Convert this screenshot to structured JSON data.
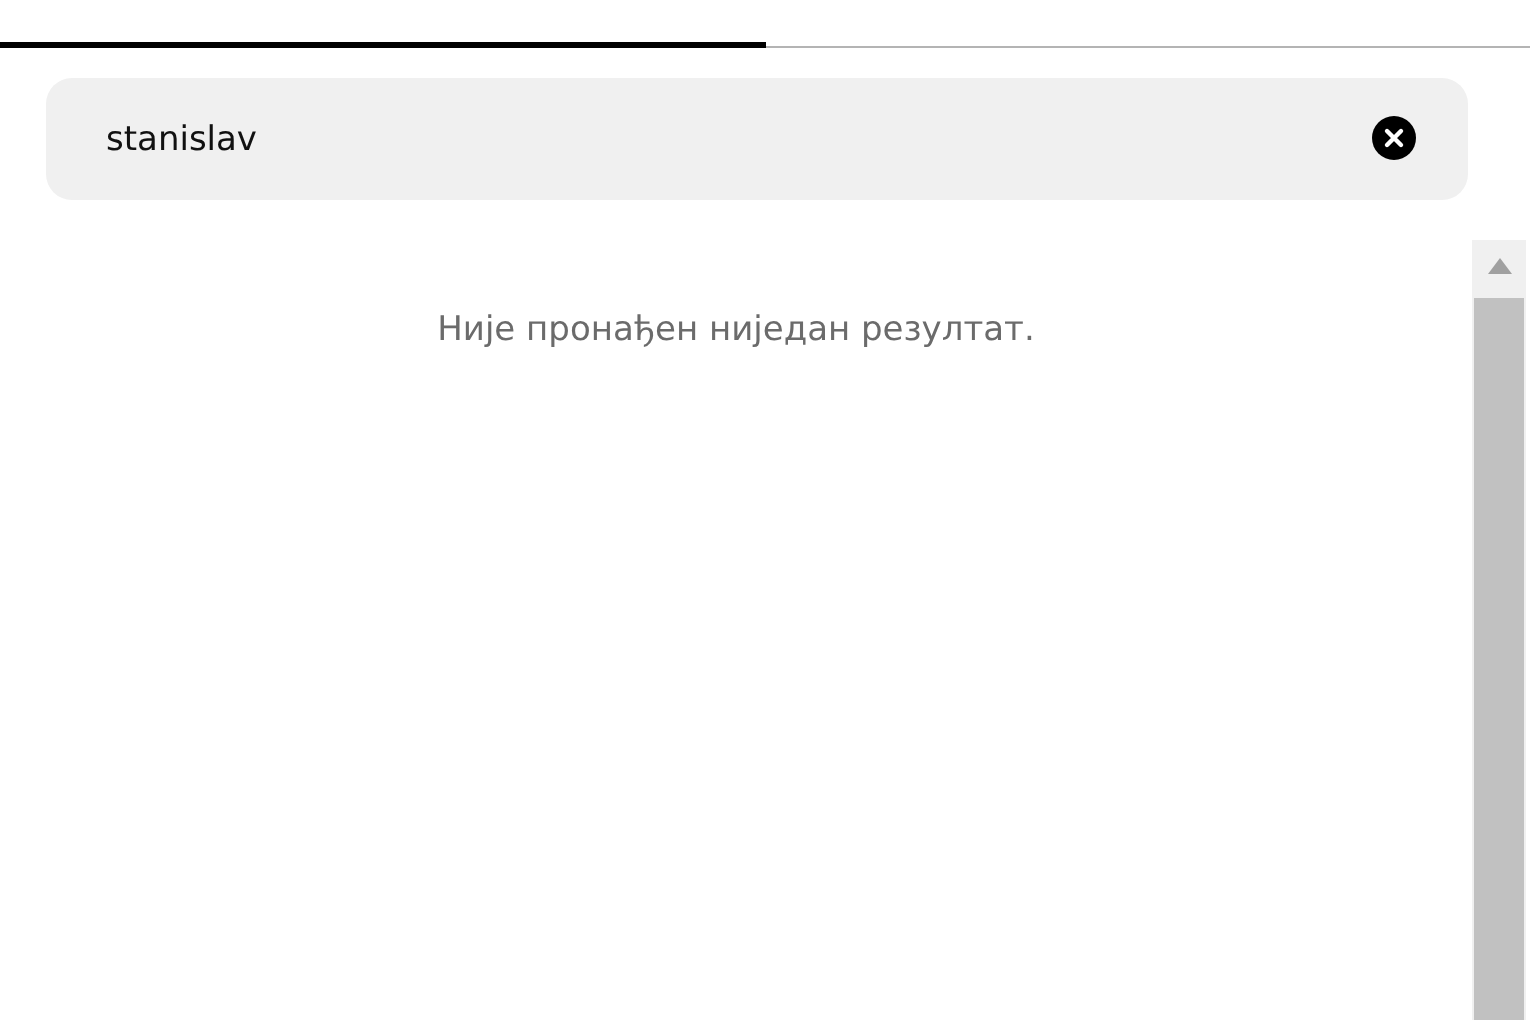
{
  "tabs": [
    {
      "selected": true
    },
    {
      "selected": false
    }
  ],
  "search": {
    "value": "stanislav"
  },
  "results": {
    "empty_message": "Није пронађен ниједан резултат."
  }
}
